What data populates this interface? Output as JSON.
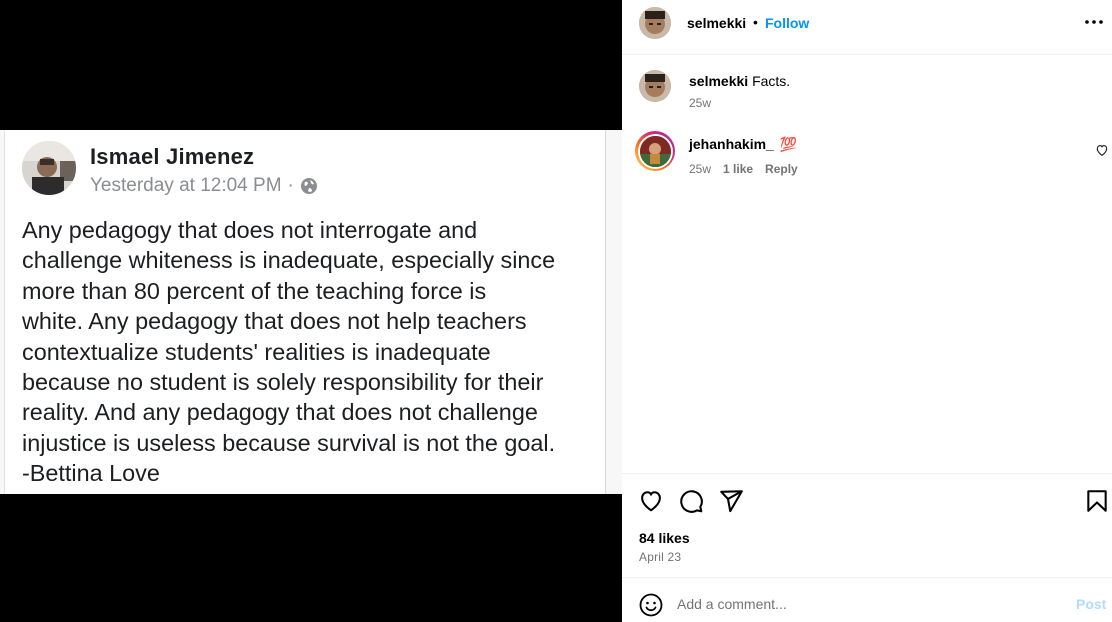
{
  "post": {
    "author": {
      "username": "selmekki",
      "separator": "•",
      "follow_label": "Follow"
    },
    "caption": {
      "username": "selmekki",
      "text": "Facts.",
      "time": "25w"
    },
    "comments": [
      {
        "username": "jehanhakim_",
        "text": "💯",
        "time": "25w",
        "likes": "1 like",
        "reply_label": "Reply"
      }
    ],
    "likes": "84 likes",
    "date": "April 23",
    "comment_input": {
      "placeholder": "Add a comment...",
      "post_label": "Post"
    }
  },
  "media": {
    "fb_post": {
      "name": "Ismael Jimenez",
      "time": "Yesterday at 12:04 PM",
      "separator": "·",
      "lines": [
        "Any pedagogy that does not interrogate and",
        "challenge whiteness is inadequate, especially since",
        "more than 80 percent of the teaching force is",
        "white. Any pedagogy that does not help teachers",
        "contextualize students' realities is inadequate",
        "because no student is solely responsibility for their",
        "reality. And any pedagogy that does not challenge",
        "injustice is useless because survival is not the goal.",
        "-Bettina Love"
      ]
    }
  },
  "colors": {
    "link_blue": "#0095f6",
    "post_disabled": "#b3dbff",
    "muted": "#737373"
  },
  "icons": {
    "more": "more-horizontal-icon",
    "like": "heart-icon",
    "comment": "comment-icon",
    "share": "send-icon",
    "save": "bookmark-icon",
    "emoji": "emoji-icon",
    "globe": "globe-icon"
  }
}
